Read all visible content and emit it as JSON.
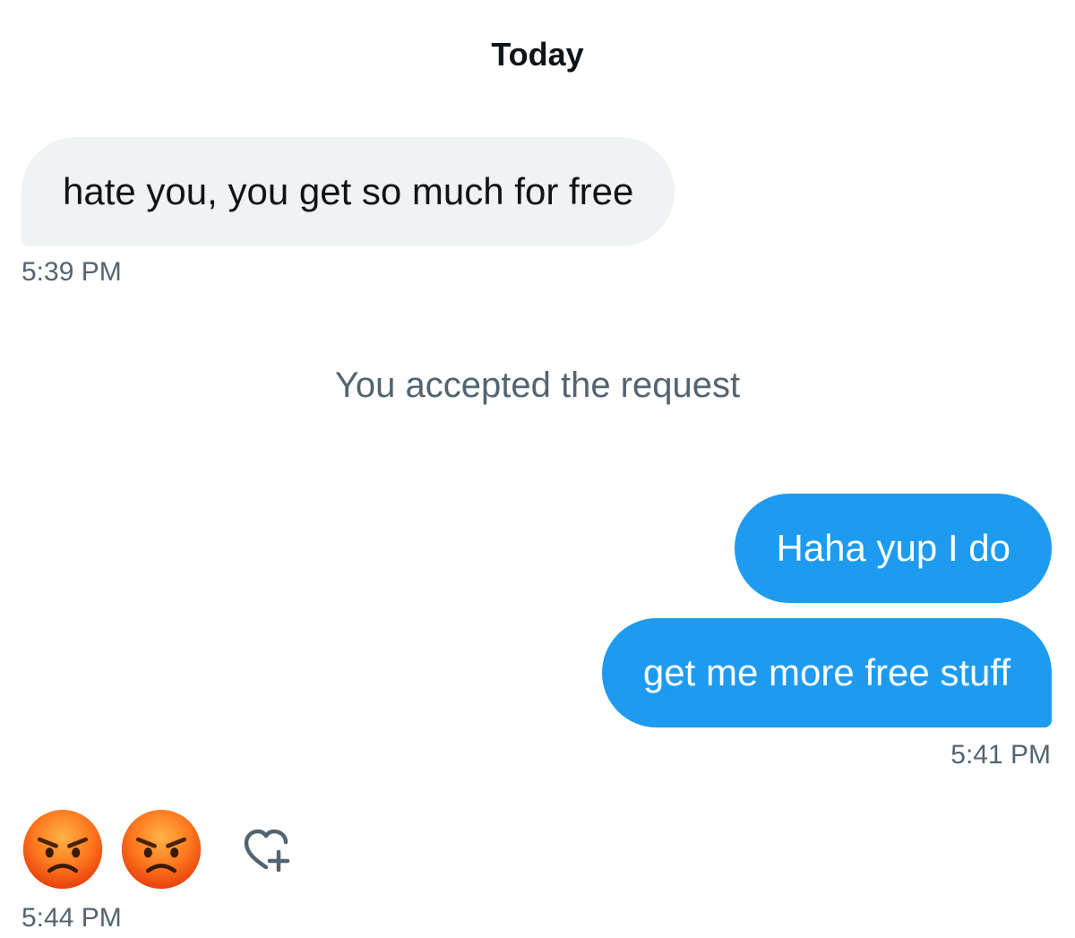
{
  "conversation": {
    "date_label": "Today",
    "messages": [
      {
        "text": "hate you, you get so much for free",
        "direction": "received"
      },
      {
        "text": "Haha yup I do",
        "direction": "sent"
      },
      {
        "text": "get me more free stuff",
        "direction": "sent"
      }
    ],
    "timestamps": [
      "5:39 PM",
      "5:41 PM",
      "5:44 PM"
    ],
    "system_note": "You accepted the request",
    "last_message_emojis": [
      "angry-face-icon",
      "angry-face-icon"
    ],
    "react_icon": "heart-plus-icon"
  },
  "colors": {
    "sent_bubble": "#1d9bf0",
    "received_bubble": "#eff3f4",
    "secondary_text": "#536471",
    "primary_text": "#0f1419"
  }
}
